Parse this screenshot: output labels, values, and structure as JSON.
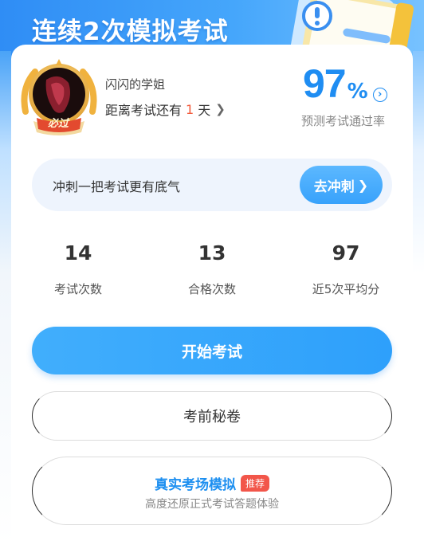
{
  "banner": {
    "title": "连续2次模拟考试"
  },
  "profile": {
    "username": "闪闪的学姐",
    "countdown_prefix": "距离考试还有",
    "countdown_days": "1",
    "countdown_suffix": "天",
    "badge_text": "必过"
  },
  "pass_rate": {
    "value": "97",
    "unit": "%",
    "label": "预测考试通过率"
  },
  "sprint": {
    "text": "冲刺一把考试更有底气",
    "button_label": "去冲刺"
  },
  "stats": [
    {
      "value": "14",
      "label": "考试次数"
    },
    {
      "value": "13",
      "label": "合格次数"
    },
    {
      "value": "97",
      "label": "近5次平均分"
    }
  ],
  "actions": {
    "start_label": "开始考试",
    "secret_label": "考前秘卷",
    "simulation_title": "真实考场模拟",
    "simulation_badge": "推荐",
    "simulation_subtitle": "高度还原正式考试答题体验"
  },
  "colors": {
    "primary": "#2ea0fb",
    "accent_blue": "#1f8df2",
    "highlight_red": "#f25a3b",
    "badge_red": "#f2564a"
  }
}
